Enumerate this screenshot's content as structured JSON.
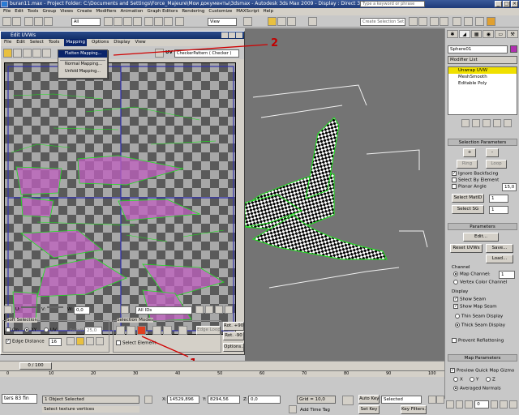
{
  "app": {
    "title": "buran11.max    - Project Folder: C:\\Documents and Settings\\Force_Majeure\\Мои документы\\3dsmax    - Autodesk 3ds Max  2009      - Display : Direct 3D",
    "search_placeholder": "Type a keyword or phrase"
  },
  "menubar": [
    "File",
    "Edit",
    "Tools",
    "Group",
    "Views",
    "Create",
    "Modifiers",
    "Animation",
    "Graph Editors",
    "Rendering",
    "Customize",
    "MAXScript",
    "Help"
  ],
  "toolbar": {
    "filter_value": "All",
    "view_value": "View",
    "named_sel_placeholder": "Create Selection Set"
  },
  "uvw": {
    "title": "Edit UVWs",
    "menus": [
      "File",
      "Edit",
      "Select",
      "Tools",
      "Mapping",
      "Options",
      "Display",
      "View"
    ],
    "uv_label": "UV",
    "texture_select": "CheckerPattern  ( Checker )",
    "mapping_menu": [
      "Flatten Mapping...",
      "Normal Mapping...",
      "Unfold Mapping..."
    ],
    "coord_labels": [
      "U:",
      "V:",
      "W:"
    ],
    "coord_value": "0,0",
    "ids_select": "All IDs",
    "soft_selection": {
      "title": "Soft Selection",
      "on": "On",
      "xy": "XY",
      "uv": "UV",
      "falloff_label": "Falloff:",
      "falloff_value": "25,0",
      "edge_distance": "Edge Distance",
      "edge_distance_value": "16"
    },
    "selection_modes": {
      "title": "Selection Modes",
      "edge_loop": "Edge Loop",
      "select_element": "Select Element"
    },
    "rotate": {
      "plus": "Rot. +90",
      "minus": "Rot. -90"
    },
    "options_btn": "Options..."
  },
  "annotations": {
    "one": "1",
    "two": "2"
  },
  "command_panel": {
    "object_name": "Sphere01",
    "modifier_list": "Modifier List",
    "stack": [
      "Unwrap UVW",
      "MeshSmooth",
      "Editable Poly"
    ],
    "selection_params": {
      "title": "Selection Parameters",
      "ring": "Ring",
      "loop": "Loop",
      "ignore_backfacing": "Ignore Backfacing",
      "select_by_element": "Select By Element",
      "planar_angle": "Planar Angle",
      "planar_angle_value": "15,0",
      "select_matid": "Select MatID",
      "select_sg": "Select SG",
      "id_value": "1"
    },
    "parameters": {
      "title": "Parameters",
      "edit": "Edit...",
      "reset_uvws": "Reset UVWs",
      "save": "Save...",
      "load": "Load...",
      "channel": "Channel",
      "map_channel": "Map Channel:",
      "map_channel_value": "1",
      "vertex_color_channel": "Vertex Color Channel",
      "display": "Display",
      "show_seam": "Show Seam",
      "show_map_seam": "Show Map Seam",
      "thin_seam_display": "Thin Seam Display",
      "thick_seam_display": "Thick Seam Display",
      "prevent_reflattening": "Prevent Reflattening"
    },
    "map_parameters": {
      "title": "Map Parameters",
      "preview_gizmo": "Preview Quick Map Gizmo",
      "x": "X",
      "y": "Y",
      "z": "Z",
      "averaged_normals": "Averaged Normals"
    }
  },
  "status": {
    "frame": "0 / 100",
    "selected": "1 Object Selected",
    "prompt": "Select texture vertices",
    "x_label": "X:",
    "x_value": "14529,896",
    "y_label": "Y:",
    "y_value": "8294,56",
    "z_label": "Z:",
    "z_value": "0,0",
    "grid": "Grid = 10,0",
    "add_time_tag": "Add Time Tag",
    "auto_key": "Auto Key",
    "set_key": "Set Key",
    "selected_dropdown": "Selected",
    "key_filters": "Key Filters...",
    "frame_value": "0",
    "script_box": "ters 83 fin",
    "tick_labels": [
      "0",
      "10",
      "20",
      "30",
      "40",
      "50",
      "60",
      "70",
      "80",
      "90",
      "100"
    ]
  }
}
